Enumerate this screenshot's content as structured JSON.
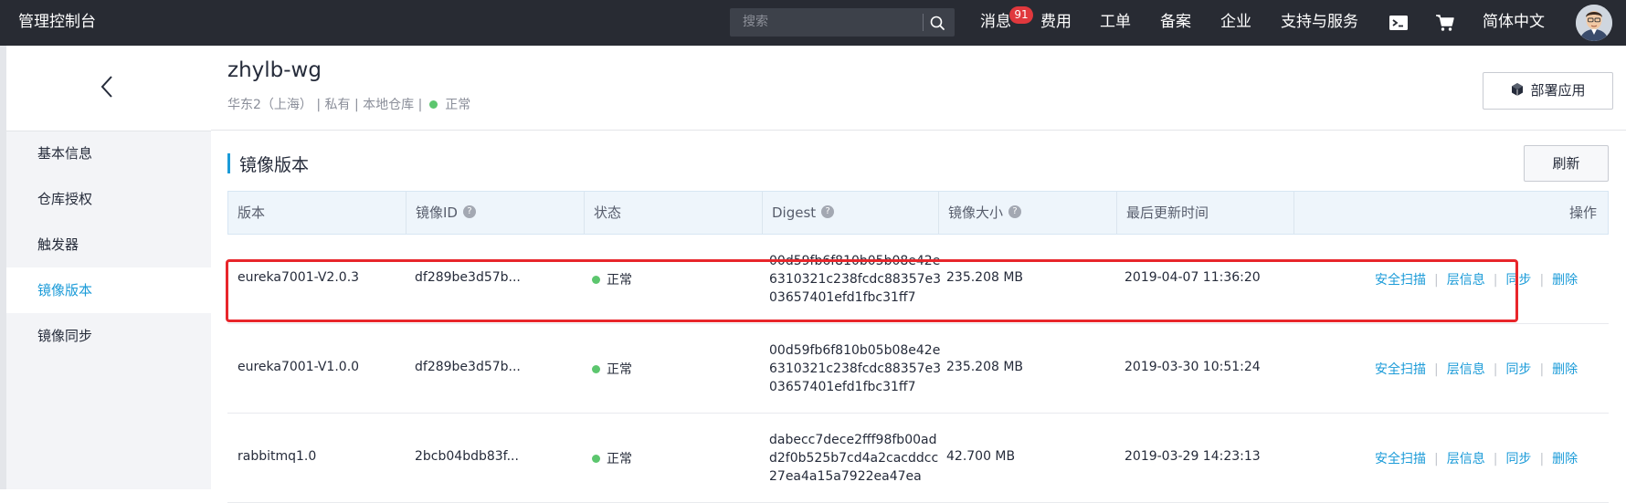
{
  "topbar": {
    "brand": "管理控制台",
    "search_placeholder": "搜索",
    "nav": [
      "消息",
      "费用",
      "工单",
      "备案",
      "企业",
      "支持与服务"
    ],
    "message_badge": "91",
    "language": "简体中文"
  },
  "sidebar": {
    "items": [
      {
        "label": "基本信息",
        "active": false
      },
      {
        "label": "仓库授权",
        "active": false
      },
      {
        "label": "触发器",
        "active": false
      },
      {
        "label": "镜像版本",
        "active": true
      },
      {
        "label": "镜像同步",
        "active": false
      }
    ]
  },
  "repo": {
    "name": "zhylb-wg",
    "region": "华东2（上海）",
    "visibility": "私有",
    "type": "本地仓库",
    "status": "正常",
    "deploy_label": "部署应用"
  },
  "section": {
    "title": "镜像版本",
    "refresh_label": "刷新"
  },
  "table": {
    "columns": [
      "版本",
      "镜像ID",
      "状态",
      "Digest",
      "镜像大小",
      "最后更新时间",
      "操作"
    ],
    "rows": [
      {
        "version": "eureka7001-V2.0.3",
        "image_id": "df289be3d57b...",
        "status": "正常",
        "digest": [
          "00d59fb6f810b05b08e42e",
          "6310321c238fcdc88357e3",
          "03657401efd1fbc31ff7"
        ],
        "size": "235.208 MB",
        "updated": "2019-04-07 11:36:20"
      },
      {
        "version": "eureka7001-V1.0.0",
        "image_id": "df289be3d57b...",
        "status": "正常",
        "digest": [
          "00d59fb6f810b05b08e42e",
          "6310321c238fcdc88357e3",
          "03657401efd1fbc31ff7"
        ],
        "size": "235.208 MB",
        "updated": "2019-03-30 10:51:24"
      },
      {
        "version": "rabbitmq1.0",
        "image_id": "2bcb04bdb83f...",
        "status": "正常",
        "digest": [
          "dabecc7dece2fff98fb00ad",
          "d2f0b525b7cd4a2cacddcc",
          "27ea4a15a7922ea47ea"
        ],
        "size": "42.700 MB",
        "updated": "2019-03-29 14:23:13"
      }
    ],
    "actions": [
      "安全扫描",
      "层信息",
      "同步",
      "删除"
    ]
  },
  "colors": {
    "topbar_bg": "#282b33",
    "accent": "#1b9bd8",
    "status_ok": "#5cc66e",
    "highlight": "#e8262b",
    "badge": "#e0383d"
  }
}
